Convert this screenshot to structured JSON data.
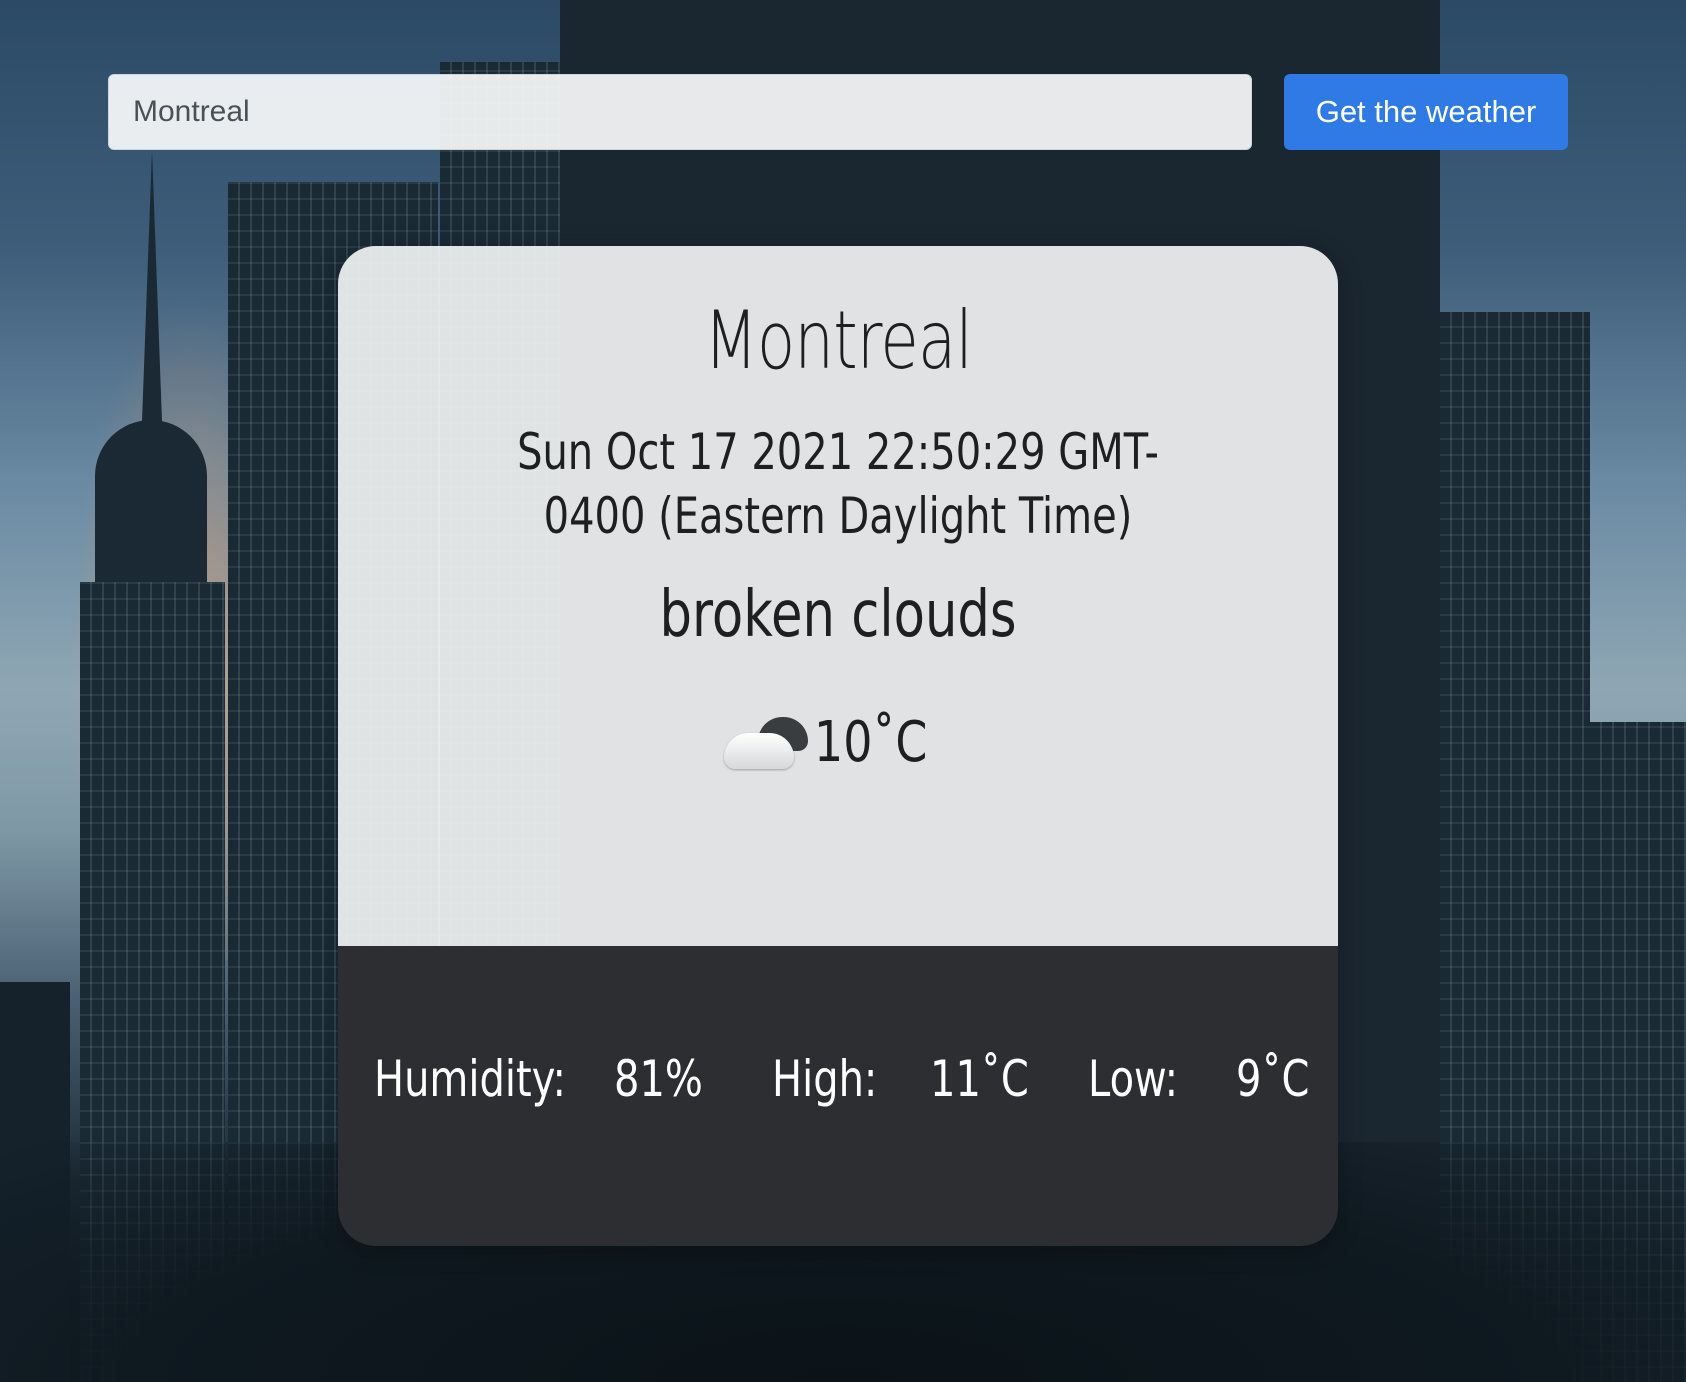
{
  "search": {
    "value": "Montreal",
    "button_label": "Get the weather"
  },
  "weather": {
    "city": "Montreal",
    "datetime": "Sun Oct 17 2021 22:50:29 GMT-0400 (Eastern Daylight Time)",
    "description": "broken clouds",
    "icon": "broken-clouds-icon",
    "temperature": "10˚C"
  },
  "details": {
    "humidity_label": "Humidity:",
    "humidity_value": "81%",
    "high_label": "High:",
    "high_value": "11˚C",
    "low_label": "Low:",
    "low_value": "9˚C"
  }
}
